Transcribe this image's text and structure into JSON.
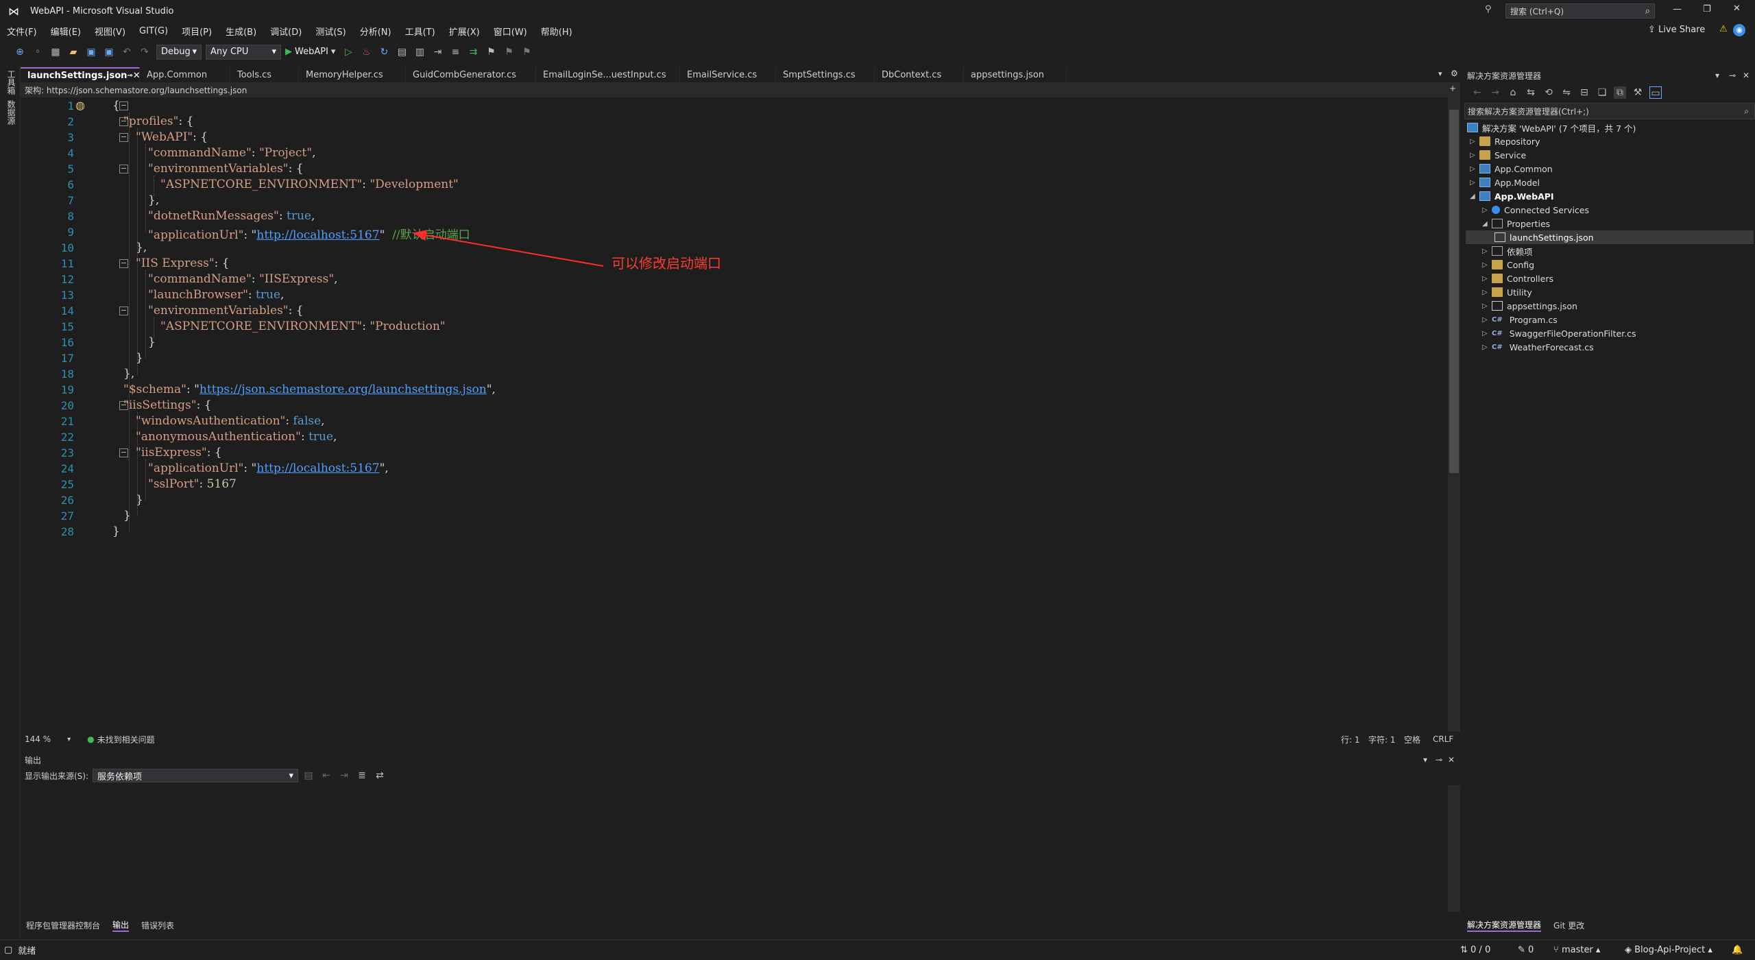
{
  "window": {
    "title": "WebAPI - Microsoft Visual Studio",
    "search_placeholder": "搜索 (Ctrl+Q)",
    "live_share": "Live Share"
  },
  "menu": [
    "文件(F)",
    "编辑(E)",
    "视图(V)",
    "GIT(G)",
    "项目(P)",
    "生成(B)",
    "调试(D)",
    "测试(S)",
    "分析(N)",
    "工具(T)",
    "扩展(X)",
    "窗口(W)",
    "帮助(H)"
  ],
  "toolbar": {
    "config": "Debug",
    "platform": "Any CPU",
    "run_target": "WebAPI"
  },
  "left_strip": [
    "工具箱",
    "数据源"
  ],
  "tabs": [
    "launchSettings.json",
    "App.Common",
    "Tools.cs",
    "MemoryHelper.cs",
    "GuidCombGenerator.cs",
    "EmailLoginSe...uestInput.cs",
    "EmailService.cs",
    "SmptSettings.cs",
    "DbContext.cs",
    "appsettings.json"
  ],
  "schema_bar": "架构: https://json.schemastore.org/launchsettings.json",
  "code": {
    "lines": [
      "1",
      "2",
      "3",
      "4",
      "5",
      "6",
      "7",
      "8",
      "9",
      "10",
      "11",
      "12",
      "13",
      "14",
      "15",
      "16",
      "17",
      "18",
      "19",
      "20",
      "21",
      "22",
      "23",
      "24",
      "25",
      "26",
      "27",
      "28"
    ],
    "keys": {
      "profiles": "\"profiles\"",
      "webapi": "\"WebAPI\"",
      "commandName": "\"commandName\"",
      "project": "\"Project\"",
      "envVars": "\"environmentVariables\"",
      "aspnetEnv": "\"ASPNETCORE_ENVIRONMENT\"",
      "development": "\"Development\"",
      "dotnetRun": "\"dotnetRunMessages\"",
      "true": "true",
      "appUrl": "\"applicationUrl\"",
      "localhost": "http://localhost:5167",
      "comment": "//默认启动端口",
      "iisExpress": "\"IIS Express\"",
      "iisExpressVal": "\"IISExpress\"",
      "launchBrowser": "\"launchBrowser\"",
      "production": "\"Production\"",
      "schema": "\"$schema\"",
      "schemaUrl": "https://json.schemastore.org/launchsettings.json",
      "iisSettings": "\"iisSettings\"",
      "windowsAuth": "\"windowsAuthentication\"",
      "false": "false",
      "anonAuth": "\"anonymousAuthentication\"",
      "iisExpressKey": "\"iisExpress\"",
      "sslPort": "\"sslPort\"",
      "port": "5167"
    }
  },
  "annotation": "可以修改启动端口",
  "editor_status": {
    "zoom": "144 %",
    "issues": "未找到相关问题",
    "line": "行: 1",
    "col": "字符: 1",
    "spaces": "空格",
    "eol": "CRLF"
  },
  "output": {
    "title": "输出",
    "source_label": "显示输出来源(S):",
    "source_value": "服务依赖项"
  },
  "bottom_tabs": [
    "程序包管理器控制台",
    "输出",
    "错误列表"
  ],
  "solution_explorer": {
    "title": "解决方案资源管理器",
    "search_placeholder": "搜索解决方案资源管理器(Ctrl+;)",
    "solution": "解决方案 'WebAPI' (7 个项目，共 7 个)",
    "items": [
      "Repository",
      "Service",
      "App.Common",
      "App.Model",
      "App.WebAPI",
      "Connected Services",
      "Properties",
      "launchSettings.json",
      "依赖项",
      "Config",
      "Controllers",
      "Utility",
      "appsettings.json",
      "Program.cs",
      "SwaggerFileOperationFilter.cs",
      "WeatherForecast.cs"
    ],
    "bottom_tabs": [
      "解决方案资源管理器",
      "Git 更改"
    ]
  },
  "statusbar": {
    "ready": "就绪",
    "changes": "0 / 0",
    "edits": "0",
    "branch": "master",
    "repo": "Blog-Api-Project"
  },
  "colors": {
    "accent": "#a06ad8",
    "annotation": "#ff3b30",
    "line_number": "#2b91af",
    "string": "#d69d85",
    "keyword": "#569cd6"
  }
}
